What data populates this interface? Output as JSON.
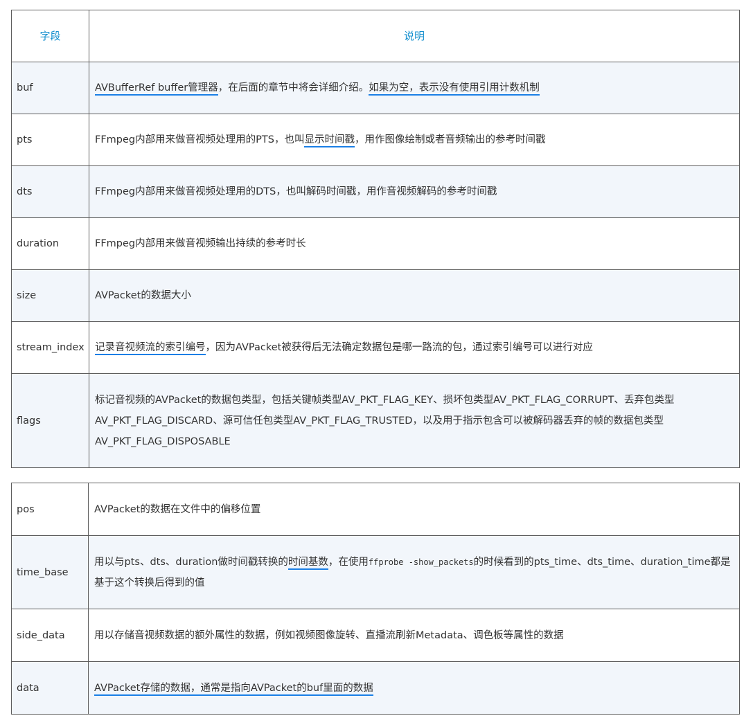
{
  "header": {
    "field": "字段",
    "desc": "说明"
  },
  "rows": [
    {
      "field": "buf",
      "desc": [
        "AVBufferRef buffer管理器",
        "，在后面的章节中将会详细介绍。",
        "如果为空，表示没有使用引用计数机制"
      ]
    },
    {
      "field": "pts",
      "desc": [
        "FFmpeg内部用来做音视频处理用的PTS，也叫",
        "显示时间戳",
        "，用作图像绘制或者音频输出的参考时间戳"
      ]
    },
    {
      "field": "dts",
      "desc": "FFmpeg内部用来做音视频处理用的DTS，也叫解码时间戳，用作音视频解码的参考时间戳"
    },
    {
      "field": "duration",
      "desc": "FFmpeg内部用来做音视频输出持续的参考时长"
    },
    {
      "field": "size",
      "desc": "AVPacket的数据大小"
    },
    {
      "field": "stream_index",
      "desc": [
        "记录音视频流的索引编号",
        "，因为AVPacket被获得后无法确定数据包是哪一路流的包，通过索引编号可以进行对应"
      ]
    },
    {
      "field": "flags",
      "desc": "标记音视频的AVPacket的数据包类型，包括关键帧类型AV_PKT_FLAG_KEY、损坏包类型AV_PKT_FLAG_CORRUPT、丢弃包类型AV_PKT_FLAG_DISCARD、源可信任包类型AV_PKT_FLAG_TRUSTED，以及用于指示包含可以被解码器丢弃的帧的数据包类型AV_PKT_FLAG_DISPOSABLE"
    }
  ],
  "rows2": [
    {
      "field": "pos",
      "desc": "AVPacket的数据在文件中的偏移位置"
    },
    {
      "field": "time_base",
      "desc": [
        "用以与pts、dts、duration做时间戳转换的",
        "时间基数",
        "，在使用",
        "ffprobe -show_packets",
        "的时候看到的pts_time、dts_time、duration_time都是基于这个转换后得到的值"
      ]
    },
    {
      "field": "side_data",
      "desc": "用以存储音视频数据的额外属性的数据，例如视频图像旋转、直播流刷新Metadata、调色板等属性的数据"
    },
    {
      "field": "data",
      "desc": "AVPacket存储的数据，通常是指向AVPacket的buf里面的数据"
    }
  ]
}
